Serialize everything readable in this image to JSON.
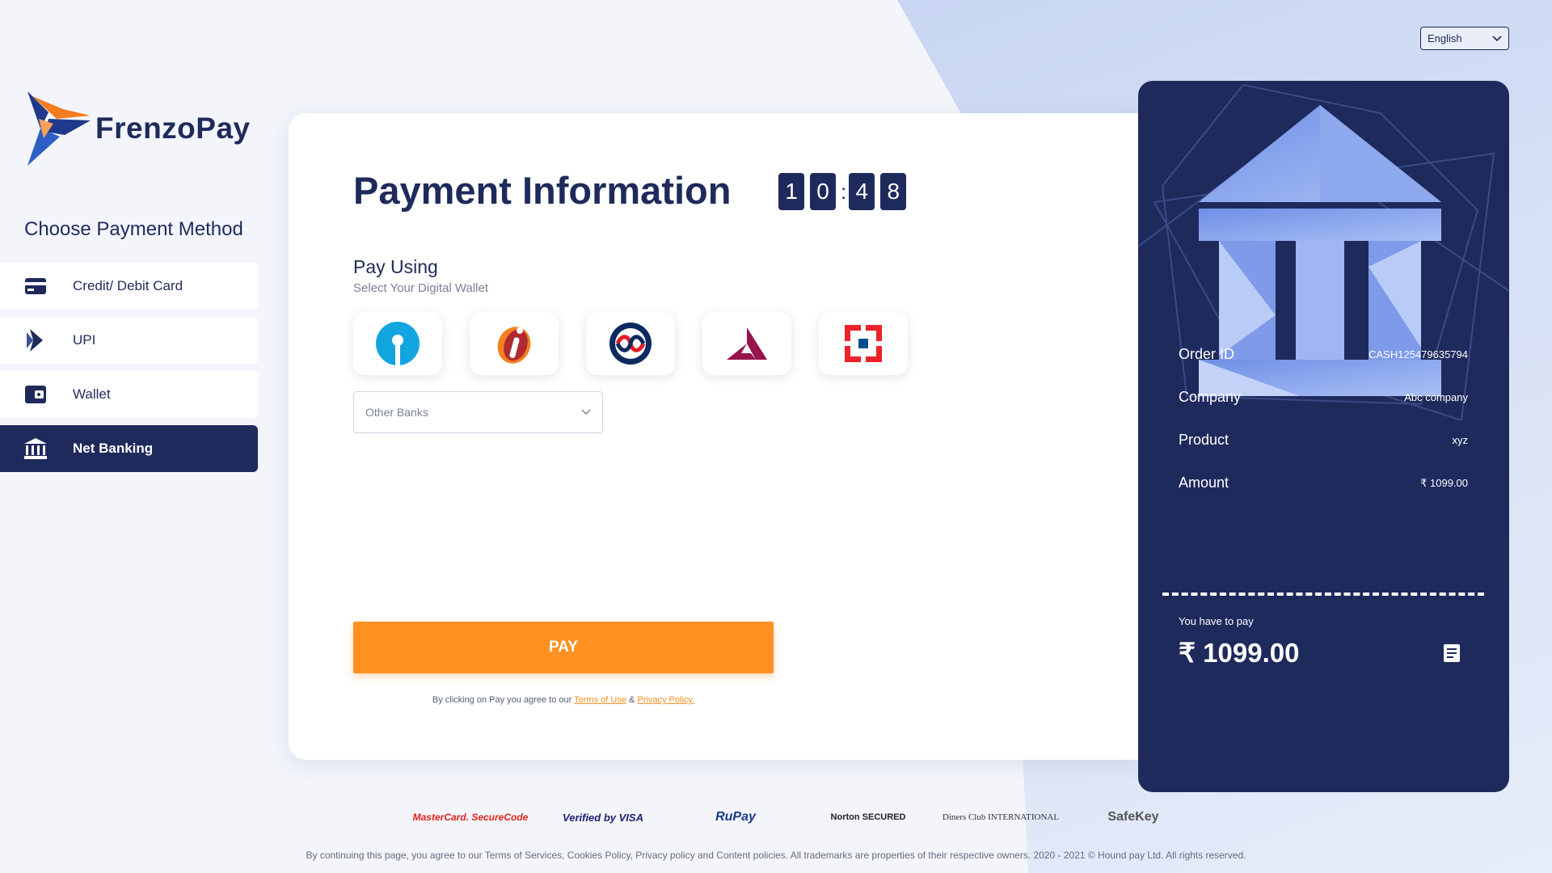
{
  "language": {
    "selected": "English"
  },
  "brand": {
    "name": "FrenzoPay"
  },
  "sidebar": {
    "title": "Choose Payment Method",
    "items": [
      {
        "label": "Credit/ Debit Card",
        "icon": "card-icon",
        "active": false
      },
      {
        "label": "UPI",
        "icon": "upi-icon",
        "active": false
      },
      {
        "label": "Wallet",
        "icon": "wallet-icon",
        "active": false
      },
      {
        "label": "Net Banking",
        "icon": "bank-icon",
        "active": true
      }
    ]
  },
  "main": {
    "title": "Payment Information",
    "timer": {
      "d1": "1",
      "d2": "0",
      "d3": "4",
      "d4": "8"
    },
    "pay_using": "Pay Using",
    "select_wallet": "Select Your Digital Wallet",
    "banks": [
      "sbi-logo",
      "icici-logo",
      "kotak-logo",
      "axis-logo",
      "hdfc-logo"
    ],
    "other_banks_placeholder": "Other Banks",
    "pay_label": "PAY",
    "agree_prefix": "By clicking on Pay you agree to our",
    "terms_label": "Terms of Use",
    "and": "&",
    "privacy_label": "Privacy Policy."
  },
  "summary": {
    "order_id_label": "Order ID",
    "order_id": "CASH125479635794",
    "company_label": "Company",
    "company": "Abc company",
    "product_label": "Product",
    "product": "xyz",
    "amount_label": "Amount",
    "amount": "₹ 1099.00",
    "you_have_to_pay": "You have to pay",
    "total": "₹ 1099.00"
  },
  "partners": [
    "MasterCard. SecureCode",
    "Verified by VISA",
    "RuPay",
    "Norton SECURED",
    "Diners Club INTERNATIONAL",
    "SafeKey"
  ],
  "footer": "By continuing this page, you agree to our Terms of Services, Cookies Policy, Privacy policy and Content policies. All trademarks are properties of their respective owners. 2020 - 2021 © Hound pay Ltd. All rights reserved.",
  "colors": {
    "navy": "#1f2a5c",
    "orange": "#ff9022",
    "bg": "#f3f5fb"
  }
}
